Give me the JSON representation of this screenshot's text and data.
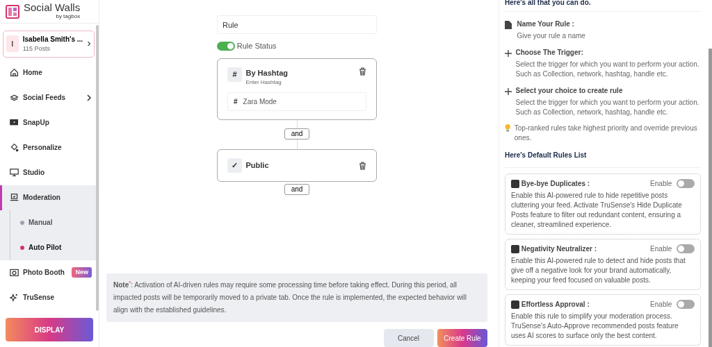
{
  "brand": {
    "name": "Social Walls",
    "byline": "by tagbox"
  },
  "account": {
    "initial": "I",
    "name": "Isabella Smith's ...",
    "posts": "115 Posts"
  },
  "sidebar": {
    "items": [
      {
        "label": "Home",
        "selected": false
      },
      {
        "label": "Social Feeds",
        "selected": false,
        "submenu": true
      },
      {
        "label": "SnapUp",
        "selected": false
      },
      {
        "label": "Personalize",
        "selected": false
      },
      {
        "label": "Studio",
        "selected": false
      },
      {
        "label": "Moderation",
        "selected": true,
        "expanded": true,
        "children": [
          {
            "label": "Manual",
            "color": "#9ca3af",
            "selected": false
          },
          {
            "label": "Auto Pilot",
            "color": "#d6336c",
            "selected": true
          }
        ]
      },
      {
        "label": "Photo Booth",
        "selected": false,
        "badge": "New"
      },
      {
        "label": "TruSense",
        "selected": false
      }
    ]
  },
  "display_button": "DISPLAY",
  "rule": {
    "name_value": "Rule",
    "status_on": true,
    "status_label": "Rule Status",
    "trigger": {
      "icon_glyph": "#",
      "title": "By Hashtag",
      "subtitle": "Enter Hashtag",
      "hashtag_glyph": "#",
      "hashtag": "Zara Mode"
    },
    "connector_1": "and",
    "action": {
      "icon_glyph": "✓",
      "title": "Public"
    },
    "connector_2": "and"
  },
  "note": "**Note**$^{*}$: Activation of AI-driven rules may require some processing time before taking effect. During this period, all impacted posts will be temporarily moved to a private tab. Once the rule is implemented, the expected behavior will align with the established guidelines.",
  "buttons": {
    "cancel": "Cancel",
    "create": "Create Rule"
  },
  "help": {
    "heading": "Here's all that you can do.",
    "steps": [
      {
        "kind": "doc",
        "title": "Name Your Rule :",
        "text": "Give your rule a name"
      },
      {
        "kind": "plus",
        "title": "Choose The Trigger:",
        "text": "Select the trigger for which you want to perform your action. Such as Collection, network, hashtag, handle etc."
      },
      {
        "kind": "plus",
        "title": "Select your choice to create rule",
        "text": "Select the trigger for which you want to perform your action. Such as Collection, network, hashtag, handle etc."
      }
    ],
    "tip": "Top-ranked rules take highest priority and override previous ones.",
    "defaults_heading": "Here's Default Rules List",
    "defaults": [
      {
        "title": "Bye-bye Duplicates :",
        "toggle_label": "Enable",
        "on": false,
        "text": "Enable this AI-powered rule to hide repetitive posts cluttering your feed. Activate TruSense's Hide Duplicate Posts feature to filter out redundant content, ensuring a cleaner, streamlined experience."
      },
      {
        "title": "Negativity Neutralizer :",
        "toggle_label": "Enable",
        "on": false,
        "text": "Enable this AI-powered rule to detect and hide posts that give off a negative look for your brand automatically, keeping your feed focused on valuable posts."
      },
      {
        "title": "Effortless Approval :",
        "toggle_label": "Enable",
        "on": false,
        "text": "Enable this rule to simplify your moderation process. TruSense's Auto-Approve recommended posts feature uses AI scores to surface only the best content."
      }
    ]
  }
}
